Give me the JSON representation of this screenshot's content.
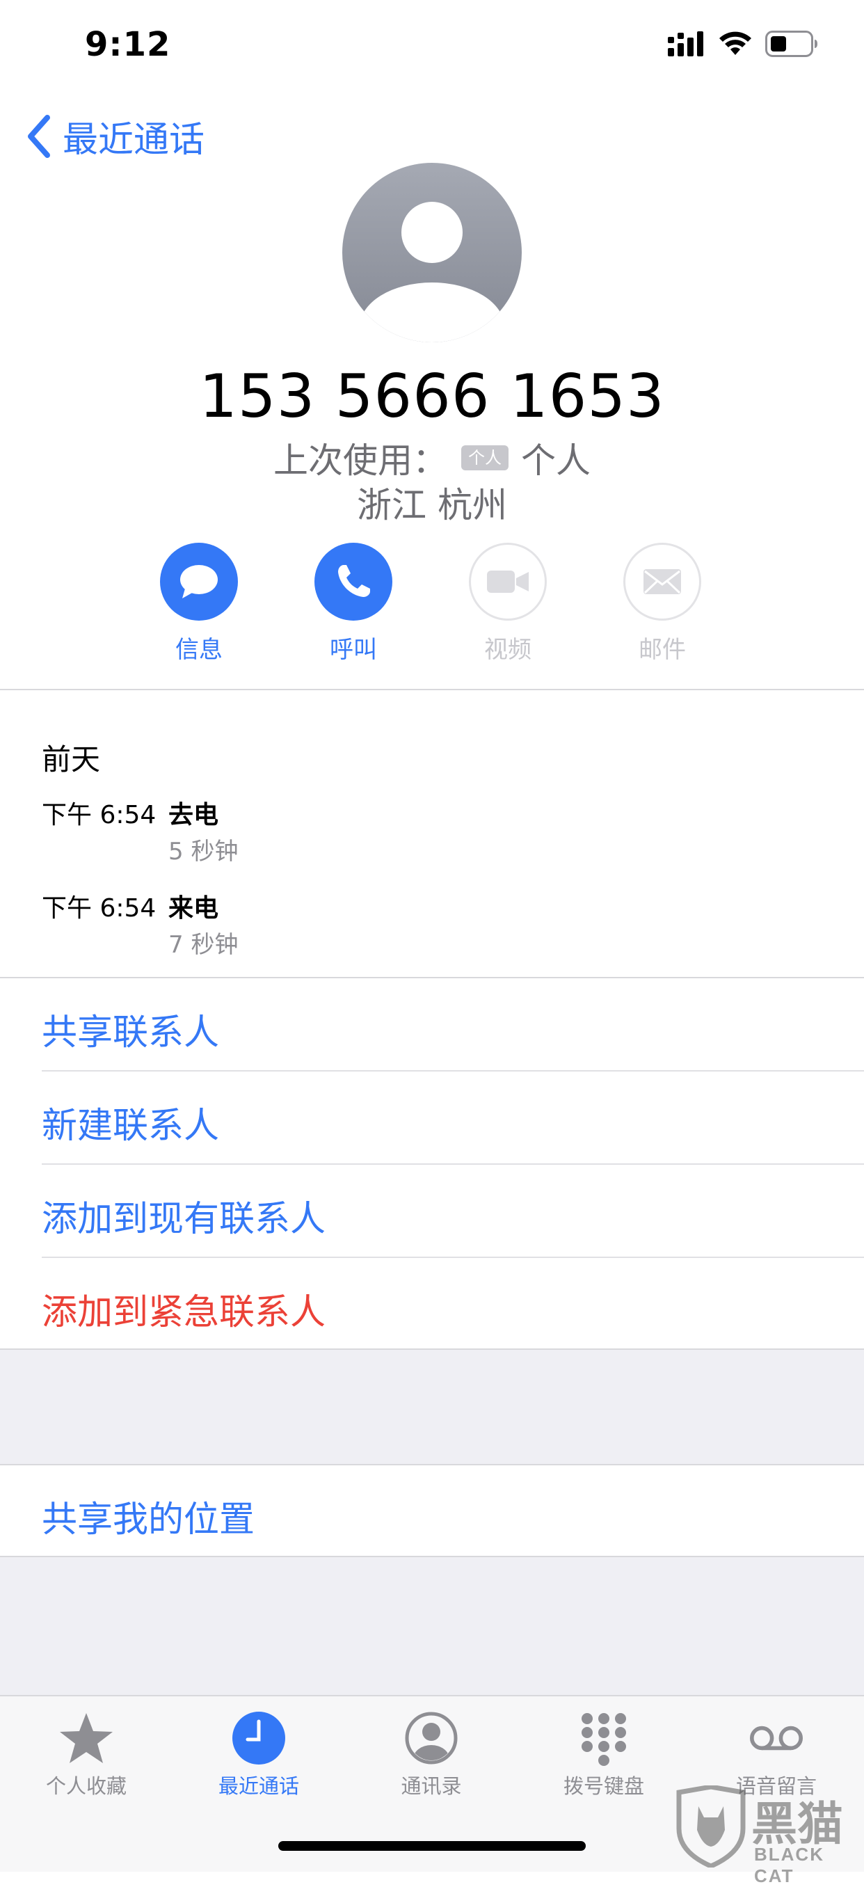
{
  "status_bar": {
    "time": "9:12"
  },
  "nav": {
    "back_label": "最近通话"
  },
  "contact": {
    "phone_number": "153 5666 1653",
    "last_used_label": "上次使用：",
    "last_used_tag": "个人",
    "last_used_value": "个人",
    "location": "浙江 杭州"
  },
  "actions": [
    {
      "label": "信息",
      "icon": "message-icon",
      "enabled": true
    },
    {
      "label": "呼叫",
      "icon": "phone-icon",
      "enabled": true
    },
    {
      "label": "视频",
      "icon": "video-icon",
      "enabled": false
    },
    {
      "label": "邮件",
      "icon": "mail-icon",
      "enabled": false
    }
  ],
  "history": {
    "date": "前天",
    "calls": [
      {
        "time": "下午 6:54",
        "type": "去电",
        "duration": "5 秒钟"
      },
      {
        "time": "下午 6:54",
        "type": "来电",
        "duration": "7 秒钟"
      }
    ]
  },
  "options": [
    {
      "label": "共享联系人",
      "style": "normal"
    },
    {
      "label": "新建联系人",
      "style": "normal"
    },
    {
      "label": "添加到现有联系人",
      "style": "normal"
    },
    {
      "label": "添加到紧急联系人",
      "style": "danger"
    }
  ],
  "location_option": {
    "label": "共享我的位置"
  },
  "tabs": [
    {
      "label": "个人收藏",
      "icon": "star-icon",
      "active": false
    },
    {
      "label": "最近通话",
      "icon": "clock-icon",
      "active": true
    },
    {
      "label": "通讯录",
      "icon": "contacts-icon",
      "active": false
    },
    {
      "label": "拨号键盘",
      "icon": "keypad-icon",
      "active": false
    },
    {
      "label": "语音留言",
      "icon": "voicemail-icon",
      "active": false
    }
  ],
  "watermark": {
    "logo_text": "黑猫",
    "sub_text": "BLACK CAT"
  },
  "colors": {
    "accent": "#3478f6",
    "danger": "#eb4137",
    "secondary_text": "#8e8e93",
    "disabled": "#c7c7cc"
  }
}
